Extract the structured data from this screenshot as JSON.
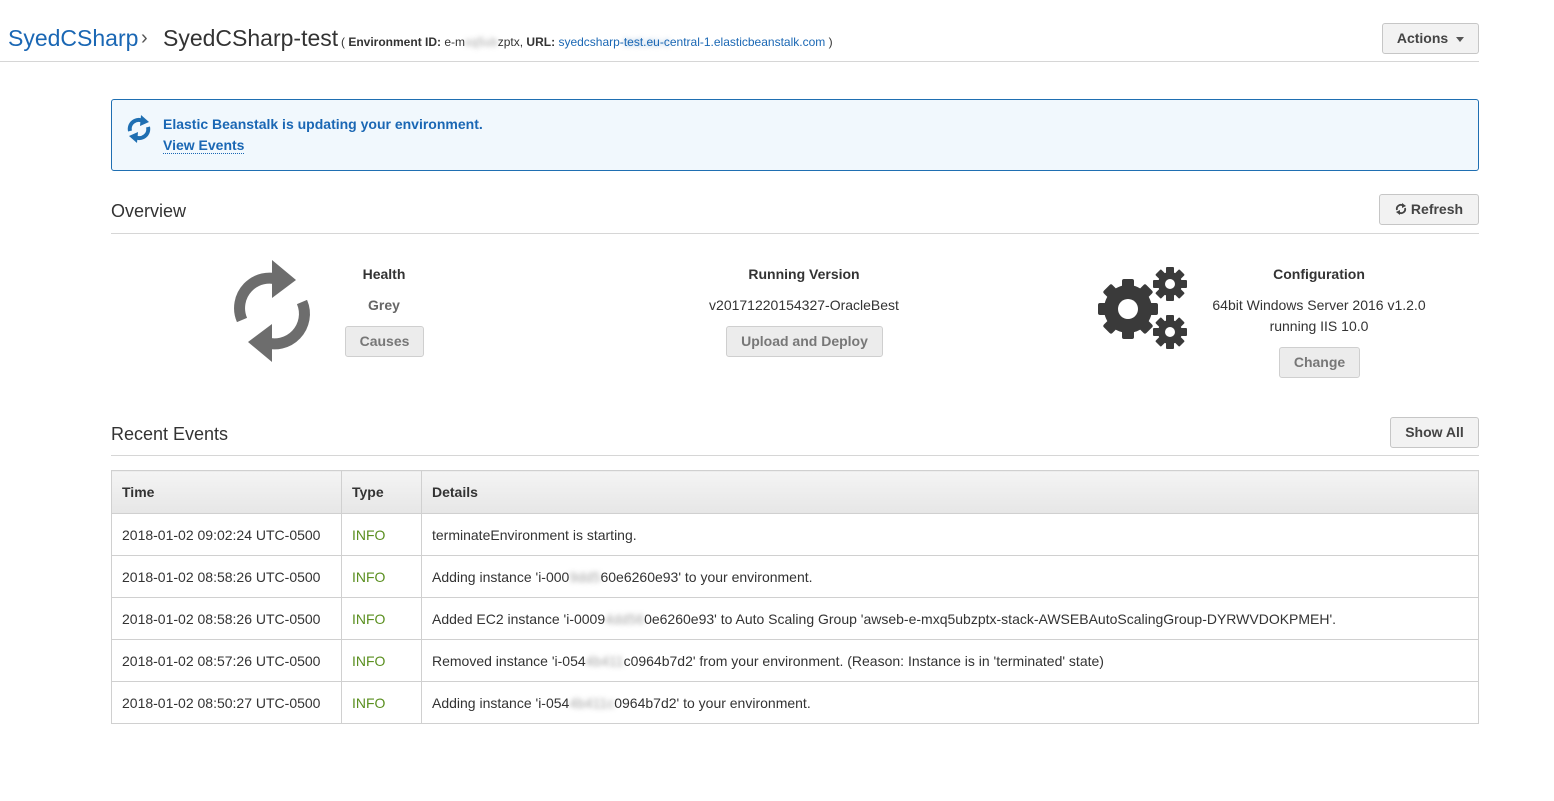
{
  "header": {
    "app_name": "SyedCSharp",
    "separator": "›",
    "env_name": "SyedCSharp-test",
    "meta_open": "(",
    "env_id_label": "Environment ID:",
    "env_id_prefix": "e-m",
    "env_id_blurred": "xq5ub",
    "env_id_suffix": "zptx,",
    "url_label": "URL:",
    "url_prefix": "syedcsharp-",
    "url_blurred": "test.eu-c",
    "url_suffix": "entral-1.elasticbeanstalk.com",
    "meta_close": ")",
    "actions_label": "Actions"
  },
  "notice": {
    "title": "Elastic Beanstalk is updating your environment.",
    "link": "View Events"
  },
  "overview": {
    "title": "Overview",
    "refresh_label": "Refresh",
    "health": {
      "label": "Health",
      "value": "Grey",
      "button": "Causes"
    },
    "version": {
      "label": "Running Version",
      "value": "v20171220154327-OracleBest",
      "button": "Upload and Deploy"
    },
    "config": {
      "label": "Configuration",
      "line1": "64bit Windows Server 2016 v1.2.0",
      "line2": "running IIS 10.0",
      "button": "Change"
    }
  },
  "events": {
    "title": "Recent Events",
    "show_all_label": "Show All",
    "columns": {
      "time": "Time",
      "type": "Type",
      "details": "Details"
    },
    "rows": [
      {
        "time": "2018-01-02 09:02:24 UTC-0500",
        "type": "INFO",
        "d1": "terminateEnvironment is starting.",
        "dblur": "",
        "d2": ""
      },
      {
        "time": "2018-01-02 08:58:26 UTC-0500",
        "type": "INFO",
        "d1": "Adding instance 'i-000",
        "dblur": "9dd5",
        "d2": "60e6260e93' to your environment."
      },
      {
        "time": "2018-01-02 08:58:26 UTC-0500",
        "type": "INFO",
        "d1": "Added EC2 instance 'i-0009",
        "dblur": "4dd56",
        "d2": "0e6260e93' to Auto Scaling Group 'awseb-e-mxq5ubzptx-stack-AWSEBAutoScalingGroup-DYRWVDOKPMEH'."
      },
      {
        "time": "2018-01-02 08:57:26 UTC-0500",
        "type": "INFO",
        "d1": "Removed instance 'i-054",
        "dblur": "4b411",
        "d2": "c0964b7d2' from your environment. (Reason: Instance is in 'terminated' state)"
      },
      {
        "time": "2018-01-02 08:50:27 UTC-0500",
        "type": "INFO",
        "d1": "Adding instance 'i-054",
        "dblur": "4b411c",
        "d2": "0964b7d2' to your environment."
      }
    ]
  }
}
